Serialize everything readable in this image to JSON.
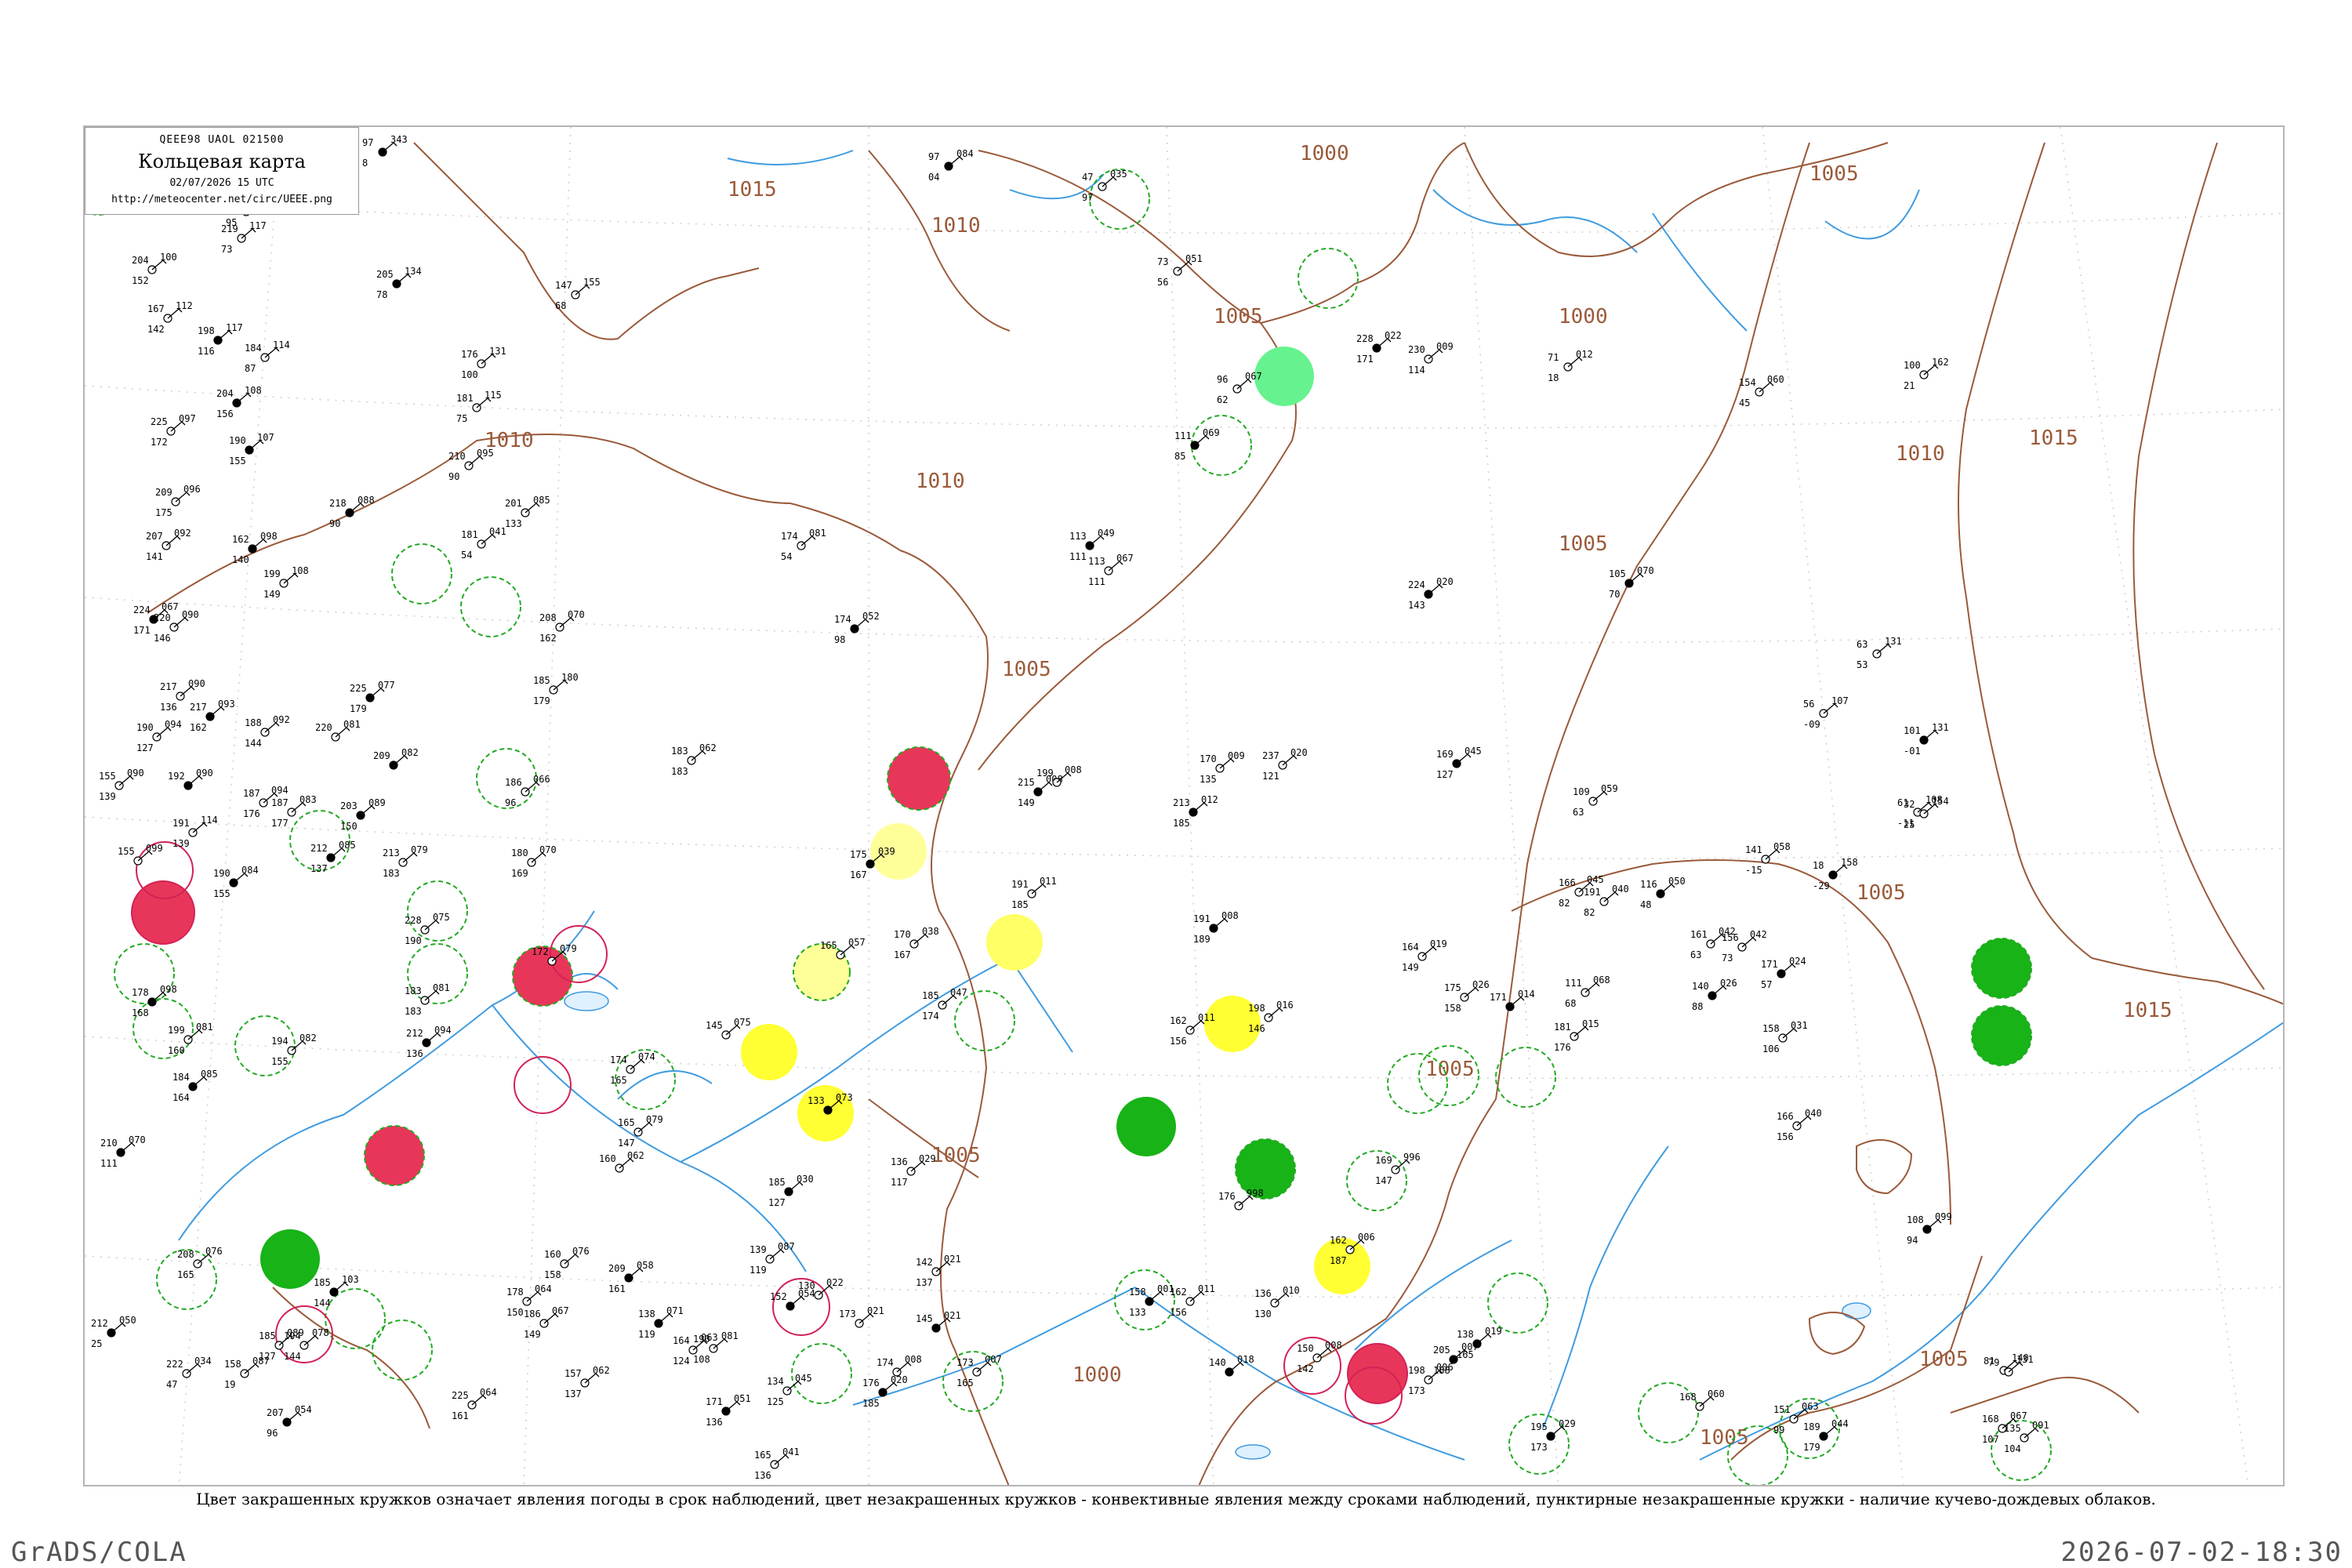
{
  "header": {
    "code_line": "QEEE98  UAOL  021500",
    "title": "Кольцевая карта",
    "date_line": "02/07/2026 15 UTC",
    "url": "http://meteocenter.net/circ/UEEE.png"
  },
  "caption": "Цвет закрашенных кружков означает явления погоды в срок наблюдений, цвет незакрашенных кружков - конвективные явления между сроками наблюдений, пунктирные незакрашенные кружки - наличие кучево-дождевых облаков.",
  "footer": {
    "left": "GrADS/COLA",
    "right": "2026-07-02-18:30"
  },
  "colors": {
    "isobar": "#9a5a3a",
    "river": "#3f9be0",
    "grid": "#cccccc",
    "red": "#e8365a",
    "yellow": "#ffff33",
    "pale_yellow": "#ffff99",
    "green": "#17b317",
    "light_green": "#66f28f",
    "dashed_green": "#22aa22",
    "ring_red": "#d22255"
  },
  "isobar_labels": [
    {
      "text": "1015"
    },
    {
      "text": "1010"
    },
    {
      "text": "1000"
    },
    {
      "text": "1005"
    },
    {
      "text": "1005"
    },
    {
      "text": "1000"
    },
    {
      "text": "1010"
    },
    {
      "text": "1010"
    },
    {
      "text": "1005"
    },
    {
      "text": "1005"
    },
    {
      "text": "1010"
    },
    {
      "text": "1015"
    },
    {
      "text": "1015"
    },
    {
      "text": "1005"
    },
    {
      "text": "1005"
    },
    {
      "text": "1000"
    },
    {
      "text": "1005"
    },
    {
      "text": "1005"
    },
    {
      "text": "1005"
    }
  ],
  "stations": [
    {
      "p": "343",
      "t": "97",
      "d": "8"
    },
    {
      "p": "152",
      "t": "176",
      "d": "49"
    },
    {
      "p": "155",
      "t": "148",
      "d": "95"
    },
    {
      "p": "084",
      "t": "97",
      "d": "04"
    },
    {
      "p": "117",
      "t": "219",
      "d": "73"
    },
    {
      "p": "100",
      "t": "204",
      "d": "152"
    },
    {
      "p": "134",
      "t": "205",
      "d": "78"
    },
    {
      "p": "155",
      "t": "147",
      "d": "68"
    },
    {
      "p": "112",
      "t": "167",
      "d": "142"
    },
    {
      "p": "117",
      "t": "198",
      "d": "116"
    },
    {
      "p": "114",
      "t": "184",
      "d": "87"
    },
    {
      "p": "131",
      "t": "176",
      "d": "100"
    },
    {
      "p": "108",
      "t": "204",
      "d": "156"
    },
    {
      "p": "115",
      "t": "181",
      "d": "75"
    },
    {
      "p": "097",
      "t": "225",
      "d": "172"
    },
    {
      "p": "107",
      "t": "190",
      "d": "155"
    },
    {
      "p": "095",
      "t": "210",
      "d": "90"
    },
    {
      "p": "096",
      "t": "209",
      "d": "175"
    },
    {
      "p": "088",
      "t": "218",
      "d": "90"
    },
    {
      "p": "085",
      "t": "201",
      "d": "133"
    },
    {
      "p": "092",
      "t": "207",
      "d": "141"
    },
    {
      "p": "098",
      "t": "162",
      "d": "140"
    },
    {
      "p": "108",
      "t": "199",
      "d": "149"
    },
    {
      "p": "041",
      "t": "181",
      "d": "54"
    },
    {
      "p": "067",
      "t": "224",
      "d": "171"
    },
    {
      "p": "090",
      "t": "220",
      "d": "146"
    },
    {
      "p": "070",
      "t": "208",
      "d": "162"
    },
    {
      "p": "052",
      "t": "174",
      "d": "98"
    },
    {
      "p": "081",
      "t": "174",
      "d": "54"
    },
    {
      "p": "090",
      "t": "217",
      "d": "136"
    },
    {
      "p": "077",
      "t": "225",
      "d": "179"
    },
    {
      "p": "180",
      "t": "185",
      "d": "179"
    },
    {
      "p": "094",
      "t": "190",
      "d": "127"
    },
    {
      "p": "093",
      "t": "217",
      "d": "162"
    },
    {
      "p": "092",
      "t": "188",
      "d": "144"
    },
    {
      "p": "081",
      "t": "220",
      "d": ""
    },
    {
      "p": "082",
      "t": "209",
      "d": ""
    },
    {
      "p": "062",
      "t": "183",
      "d": "183"
    },
    {
      "p": "090",
      "t": "155",
      "d": "139"
    },
    {
      "p": "090",
      "t": "192",
      "d": ""
    },
    {
      "p": "094",
      "t": "187",
      "d": "176"
    },
    {
      "p": "083",
      "t": "187",
      "d": "177"
    },
    {
      "p": "089",
      "t": "203",
      "d": "150"
    },
    {
      "p": "066",
      "t": "186",
      "d": "96"
    },
    {
      "p": "070",
      "t": "180",
      "d": "169"
    },
    {
      "p": "085",
      "t": "212",
      "d": "137"
    },
    {
      "p": "079",
      "t": "213",
      "d": "183"
    },
    {
      "p": "114",
      "t": "191",
      "d": "139"
    },
    {
      "p": "084",
      "t": "190",
      "d": "155"
    },
    {
      "p": "099",
      "t": "155",
      "d": ""
    },
    {
      "p": "075",
      "t": "228",
      "d": "190"
    },
    {
      "p": "098",
      "t": "178",
      "d": "168"
    },
    {
      "p": "081",
      "t": "183",
      "d": "183"
    },
    {
      "p": "081",
      "t": "199",
      "d": "160"
    },
    {
      "p": "085",
      "t": "184",
      "d": "164"
    },
    {
      "p": "082",
      "t": "194",
      "d": "155"
    },
    {
      "p": "079",
      "t": "172",
      "d": ""
    },
    {
      "p": "094",
      "t": "212",
      "d": "136"
    },
    {
      "p": "074",
      "t": "174",
      "d": "165"
    },
    {
      "p": "079",
      "t": "165",
      "d": "147"
    },
    {
      "p": "070",
      "t": "210",
      "d": "111"
    },
    {
      "p": "062",
      "t": "160",
      "d": ""
    },
    {
      "p": "076",
      "t": "208",
      "d": "165"
    },
    {
      "p": "103",
      "t": "185",
      "d": "144"
    },
    {
      "p": "078",
      "t": "194",
      "d": "144"
    },
    {
      "p": "089",
      "t": "185",
      "d": "127"
    },
    {
      "p": "050",
      "t": "212",
      "d": "25"
    },
    {
      "p": "034",
      "t": "222",
      "d": "47"
    },
    {
      "p": "087",
      "t": "158",
      "d": "19"
    },
    {
      "p": "054",
      "t": "207",
      "d": "96"
    },
    {
      "p": "064",
      "t": "225",
      "d": "161"
    },
    {
      "p": "076",
      "t": "160",
      "d": "158"
    },
    {
      "p": "058",
      "t": "209",
      "d": "161"
    },
    {
      "p": "064",
      "t": "178",
      "d": "150"
    },
    {
      "p": "067",
      "t": "186",
      "d": "149"
    },
    {
      "p": "071",
      "t": "138",
      "d": "119"
    },
    {
      "p": "062",
      "t": "157",
      "d": "137"
    },
    {
      "p": "063",
      "t": "164",
      "d": "124"
    },
    {
      "p": "051",
      "t": "171",
      "d": "136"
    },
    {
      "p": "041",
      "t": "165",
      "d": "136"
    },
    {
      "p": "022",
      "t": "130",
      "d": ""
    },
    {
      "p": "030",
      "t": "185",
      "d": "127"
    },
    {
      "p": "045",
      "t": "134",
      "d": "125"
    },
    {
      "p": "081",
      "t": "190",
      "d": "108"
    },
    {
      "p": "054",
      "t": "152",
      "d": ""
    },
    {
      "p": "087",
      "t": "139",
      "d": "119"
    },
    {
      "p": "021",
      "t": "173",
      "d": ""
    },
    {
      "p": "020",
      "t": "176",
      "d": "185"
    },
    {
      "p": "008",
      "t": "174",
      "d": ""
    },
    {
      "p": "021",
      "t": "142",
      "d": "137"
    },
    {
      "p": "021",
      "t": "145",
      "d": ""
    },
    {
      "p": "007",
      "t": "173",
      "d": "165"
    },
    {
      "p": "029",
      "t": "136",
      "d": "117"
    },
    {
      "p": "039",
      "t": "175",
      "d": "167"
    },
    {
      "p": "057",
      "t": "165",
      "d": ""
    },
    {
      "p": "075",
      "t": "145",
      "d": ""
    },
    {
      "p": "073",
      "t": "133",
      "d": ""
    },
    {
      "p": "038",
      "t": "170",
      "d": "167"
    },
    {
      "p": "047",
      "t": "185",
      "d": "174"
    },
    {
      "p": "008",
      "t": "215",
      "d": "149"
    },
    {
      "p": "008",
      "t": "199",
      "d": ""
    },
    {
      "p": "011",
      "t": "191",
      "d": "185"
    },
    {
      "p": "012",
      "t": "213",
      "d": "185"
    },
    {
      "p": "009",
      "t": "170",
      "d": "135"
    },
    {
      "p": "020",
      "t": "237",
      "d": "121"
    },
    {
      "p": "008",
      "t": "191",
      "d": "189"
    },
    {
      "p": "016",
      "t": "198",
      "d": "146"
    },
    {
      "p": "011",
      "t": "162",
      "d": "156"
    },
    {
      "p": "049",
      "t": "113",
      "d": "111"
    },
    {
      "p": "067",
      "t": "113",
      "d": "111"
    },
    {
      "p": "051",
      "t": "73",
      "d": "56"
    },
    {
      "p": "069",
      "t": "111",
      "d": "85"
    },
    {
      "p": "067",
      "t": "96",
      "d": "62"
    },
    {
      "p": "035",
      "t": "47",
      "d": "97"
    },
    {
      "p": "022",
      "t": "228",
      "d": "171"
    },
    {
      "p": "009",
      "t": "230",
      "d": "114"
    },
    {
      "p": "012",
      "t": "71",
      "d": "18"
    },
    {
      "p": "020",
      "t": "224",
      "d": "143"
    },
    {
      "p": "060",
      "t": "154",
      "d": "45"
    },
    {
      "p": "162",
      "t": "100",
      "d": "21"
    },
    {
      "p": "070",
      "t": "105",
      "d": "70"
    },
    {
      "p": "131",
      "t": "63",
      "d": "53"
    },
    {
      "p": "107",
      "t": "56",
      "d": "-09"
    },
    {
      "p": "131",
      "t": "101",
      "d": "-01"
    },
    {
      "p": "108",
      "t": "61",
      "d": "-11"
    },
    {
      "p": "154",
      "t": "32",
      "d": "25"
    },
    {
      "p": "045",
      "t": "169",
      "d": "127"
    },
    {
      "p": "059",
      "t": "109",
      "d": "63"
    },
    {
      "p": "058",
      "t": "141",
      "d": "-15"
    },
    {
      "p": "158",
      "t": "18",
      "d": "-29"
    },
    {
      "p": "045",
      "t": "166",
      "d": "82"
    },
    {
      "p": "040",
      "t": "191",
      "d": "82"
    },
    {
      "p": "050",
      "t": "116",
      "d": "48"
    },
    {
      "p": "042",
      "t": "161",
      "d": "63"
    },
    {
      "p": "042",
      "t": "156",
      "d": "73"
    },
    {
      "p": "024",
      "t": "171",
      "d": "57"
    },
    {
      "p": "019",
      "t": "164",
      "d": "149"
    },
    {
      "p": "026",
      "t": "175",
      "d": "158"
    },
    {
      "p": "014",
      "t": "171",
      "d": ""
    },
    {
      "p": "015",
      "t": "181",
      "d": "176"
    },
    {
      "p": "068",
      "t": "111",
      "d": "68"
    },
    {
      "p": "026",
      "t": "140",
      "d": "88"
    },
    {
      "p": "031",
      "t": "158",
      "d": "106"
    },
    {
      "p": "040",
      "t": "166",
      "d": "156"
    },
    {
      "p": "099",
      "t": "108",
      "d": "94"
    },
    {
      "p": "140",
      "t": "81",
      "d": ""
    },
    {
      "p": "131",
      "t": "79",
      "d": ""
    },
    {
      "p": "029",
      "t": "195",
      "d": "173"
    },
    {
      "p": "060",
      "t": "168",
      "d": ""
    },
    {
      "p": "063",
      "t": "151",
      "d": "99"
    },
    {
      "p": "044",
      "t": "189",
      "d": "179"
    },
    {
      "p": "067",
      "t": "168",
      "d": "107"
    },
    {
      "p": "091",
      "t": "135",
      "d": "104"
    },
    {
      "p": "019",
      "t": "138",
      "d": "165"
    },
    {
      "p": "006",
      "t": "162",
      "d": "187"
    },
    {
      "p": "006",
      "t": "198",
      "d": "173"
    },
    {
      "p": "007",
      "t": "205",
      "d": "188"
    },
    {
      "p": "008",
      "t": "150",
      "d": "142"
    },
    {
      "p": "010",
      "t": "136",
      "d": "130"
    },
    {
      "p": "001",
      "t": "158",
      "d": "133"
    },
    {
      "p": "011",
      "t": "162",
      "d": "156"
    },
    {
      "p": "996",
      "t": "169",
      "d": "147"
    },
    {
      "p": "018",
      "t": "140",
      "d": ""
    },
    {
      "p": "998",
      "t": "176",
      "d": ""
    }
  ]
}
